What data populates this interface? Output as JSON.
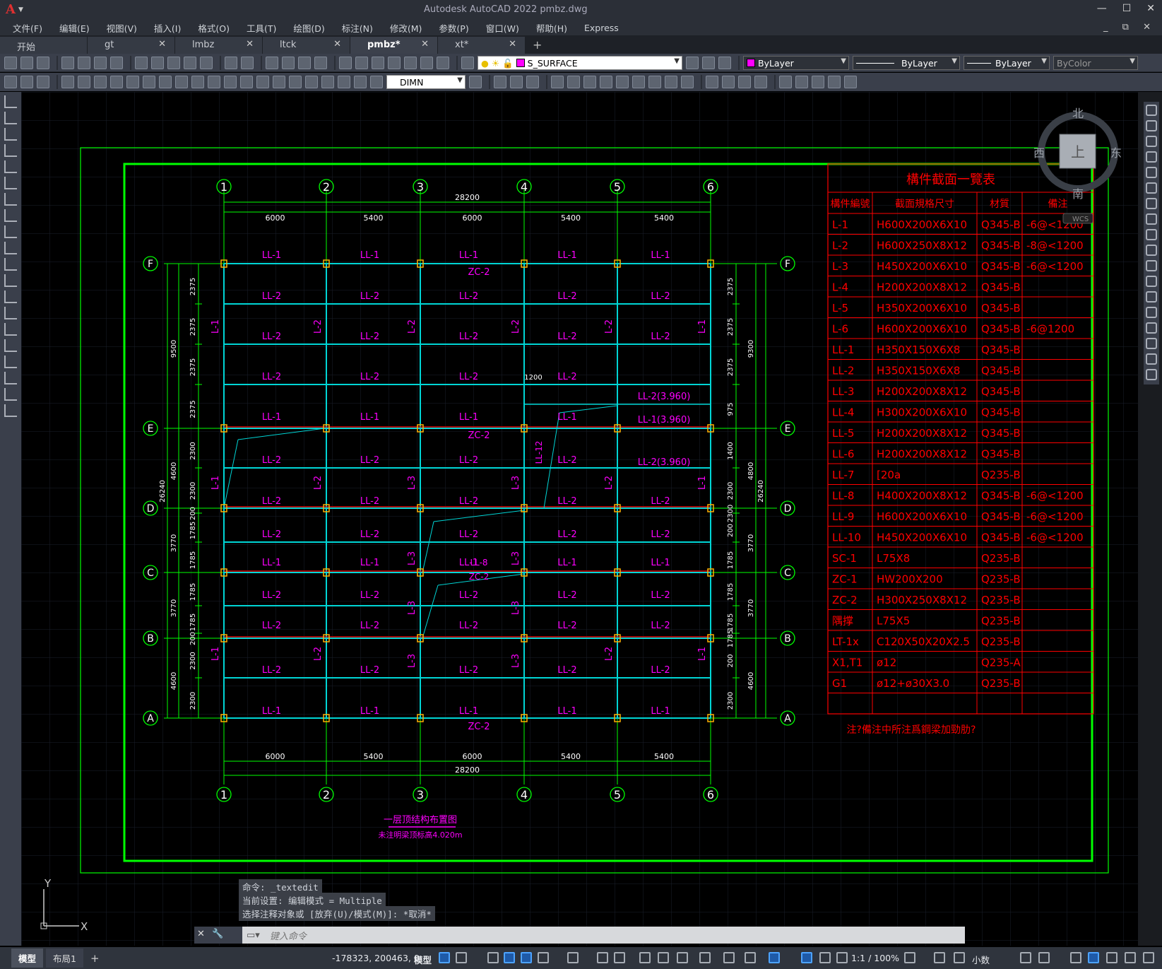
{
  "window": {
    "title": "Autodesk AutoCAD 2022    pmbz.dwg",
    "logo": "A"
  },
  "menu": [
    "文件(F)",
    "编辑(E)",
    "视图(V)",
    "插入(I)",
    "格式(O)",
    "工具(T)",
    "绘图(D)",
    "标注(N)",
    "修改(M)",
    "参数(P)",
    "窗口(W)",
    "帮助(H)",
    "Express"
  ],
  "tabs": [
    {
      "label": "开始"
    },
    {
      "label": "gt"
    },
    {
      "label": "lmbz"
    },
    {
      "label": "ltck"
    },
    {
      "label": "pmbz*",
      "active": true
    },
    {
      "label": "xt*"
    }
  ],
  "toolbar": {
    "layer": "S_SURFACE",
    "color": "ByLayer",
    "linetype": "ByLayer",
    "lineweight": "ByLayer",
    "plotstyle": "ByColor",
    "dimstyle": "DIMN"
  },
  "viewcube": {
    "north": "北",
    "south": "南",
    "east": "东",
    "west": "西",
    "face": "上",
    "wcs": "WCS"
  },
  "drawing": {
    "col_labels": [
      "1",
      "2",
      "3",
      "4",
      "5",
      "6"
    ],
    "row_labels": [
      "F",
      "E",
      "D",
      "C",
      "B",
      "A"
    ],
    "bay_dims": [
      "6000",
      "5400",
      "6000",
      "5400",
      "5400"
    ],
    "total_dim": "28200",
    "left_dims": [
      "2375",
      "2375",
      "2375",
      "2375",
      "2300",
      "2300",
      "200",
      "1785",
      "1785",
      "1785",
      "1785",
      "200",
      "2300",
      "2300"
    ],
    "left_outer": [
      "9500",
      "4600",
      "3770",
      "3770",
      "4600"
    ],
    "overall_v": "26240",
    "right_dims": [
      "2375",
      "2375",
      "2375",
      "975",
      "1400",
      "2300",
      "2300",
      "200",
      "1785",
      "1785",
      "1785",
      "1785",
      "200",
      "2300",
      "2300"
    ],
    "right_outer": [
      "9300",
      "4800",
      "3770",
      "3770",
      "4600"
    ],
    "dim_1200": "1200",
    "beams": {
      "LL1": "LL-1",
      "LL2": "LL-2",
      "ZC2": "ZC-2",
      "L1": "L-1",
      "L2": "L-2",
      "L3": "L-3",
      "LL8": "LL-8",
      "LL2e": "LL-2(3.960)",
      "LL1e": "LL-1(3.960)",
      "LL12": "LL-12"
    },
    "plan_title": "一层顶结构布置图",
    "plan_subtitle": "未注明梁顶标高4.020m"
  },
  "table": {
    "title": "構件截面一覽表",
    "headers": [
      "構件編號",
      "截面規格尺寸",
      "材質",
      "備注"
    ],
    "rows": [
      [
        "L-1",
        "H600X200X6X10",
        "Q345-B",
        "-6@<1200"
      ],
      [
        "L-2",
        "H600X250X8X12",
        "Q345-B",
        "-8@<1200"
      ],
      [
        "L-3",
        "H450X200X6X10",
        "Q345-B",
        "-6@<1200"
      ],
      [
        "L-4",
        "H200X200X8X12",
        "Q345-B",
        ""
      ],
      [
        "L-5",
        "H350X200X6X10",
        "Q345-B",
        ""
      ],
      [
        "L-6",
        "H600X200X6X10",
        "Q345-B",
        "-6@1200"
      ],
      [
        "LL-1",
        "H350X150X6X8",
        "Q345-B",
        ""
      ],
      [
        "LL-2",
        "H350X150X6X8",
        "Q345-B",
        ""
      ],
      [
        "LL-3",
        "H200X200X8X12",
        "Q345-B",
        ""
      ],
      [
        "LL-4",
        "H300X200X6X10",
        "Q345-B",
        ""
      ],
      [
        "LL-5",
        "H200X200X8X12",
        "Q345-B",
        ""
      ],
      [
        "LL-6",
        "H200X200X8X12",
        "Q345-B",
        ""
      ],
      [
        "LL-7",
        "[20a",
        "Q235-B",
        ""
      ],
      [
        "LL-8",
        "H400X200X8X12",
        "Q345-B",
        "-6@<1200"
      ],
      [
        "LL-9",
        "H600X200X6X10",
        "Q345-B",
        "-6@<1200"
      ],
      [
        "LL-10",
        "H450X200X6X10",
        "Q345-B",
        "-6@<1200"
      ],
      [
        "SC-1",
        "L75X8",
        "Q235-B",
        ""
      ],
      [
        "ZC-1",
        "HW200X200",
        "Q235-B",
        ""
      ],
      [
        "ZC-2",
        "H300X250X8X12",
        "Q235-B",
        ""
      ],
      [
        "隅撑",
        "L75X5",
        "Q235-B",
        ""
      ],
      [
        "LT-1x",
        "C120X50X20X2.5",
        "Q235-B",
        ""
      ],
      [
        "X1,T1",
        "ø12",
        "Q235-A",
        ""
      ],
      [
        "G1",
        "ø12+ø30X3.0",
        "Q235-B",
        ""
      ],
      [
        "",
        "",
        "",
        ""
      ]
    ],
    "note": "注?備注中所注爲鋼梁加勁肋?"
  },
  "ucs": {
    "x": "X",
    "y": "Y"
  },
  "command": {
    "history": [
      "命令: _textedit",
      "当前设置: 编辑模式 = Multiple",
      "选择注释对象或 [放弃(U)/模式(M)]: *取消*"
    ],
    "placeholder": "键入命令"
  },
  "status": {
    "tabs": [
      "模型",
      "布局1"
    ],
    "coords": "-178323, 200463, 0",
    "model": "模型",
    "scale": "1:1 / 100%",
    "units": "小数"
  },
  "colors": {
    "green": "#00ff00",
    "cyan": "#00d5d5",
    "magenta": "#ff00ff",
    "red": "#ff0000",
    "grid": "#1e2330"
  }
}
